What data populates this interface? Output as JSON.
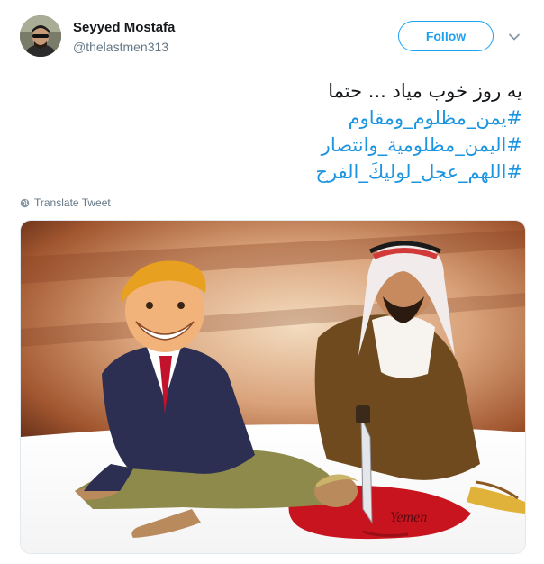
{
  "author": {
    "display_name": "Seyyed Mostafa",
    "handle": "@thelastmen313"
  },
  "actions": {
    "follow_label": "Follow"
  },
  "tweet": {
    "text_line": "یه روز خوب میاد ... حتما",
    "hashtags": [
      "#یمن_مظلوم_ومقاوم",
      "#اليمن_مظلومية_وانتصار",
      "#اللهم_عجل_لوليكَ_الفرج"
    ]
  },
  "translate": {
    "label": "Translate Tweet"
  },
  "media": {
    "caption_in_image": "Yemen"
  },
  "colors": {
    "link_blue": "#1b95e0",
    "follow_blue": "#1da1f2",
    "secondary_text": "#657786",
    "primary_text": "#14171a"
  }
}
